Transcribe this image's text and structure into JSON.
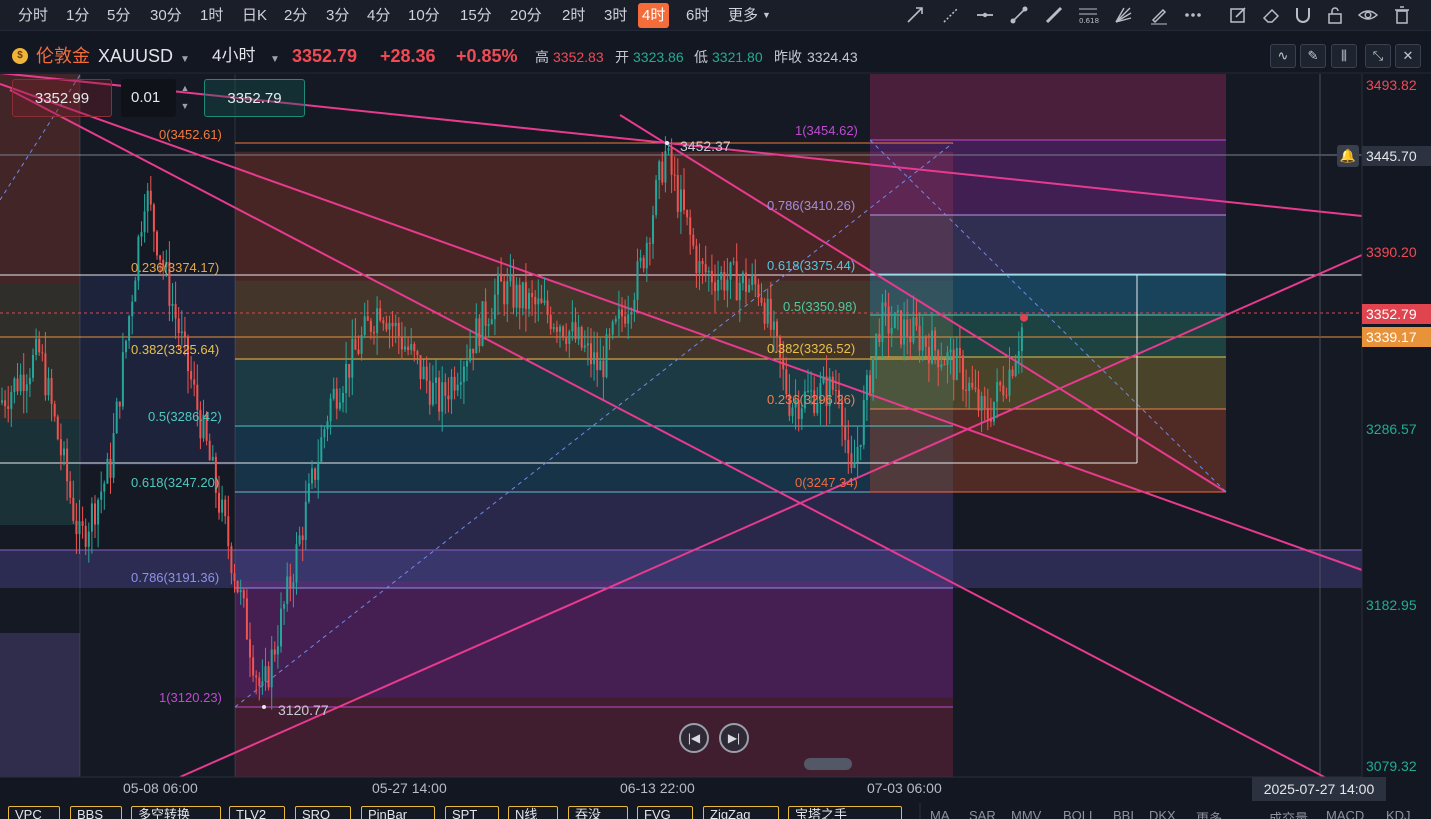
{
  "timeframes": [
    "分时",
    "1分",
    "5分",
    "30分",
    "1时",
    "日K",
    "2分",
    "3分",
    "4分",
    "10分",
    "15分",
    "20分",
    "2时",
    "3时",
    "4时",
    "6时",
    "更多"
  ],
  "active_timeframe": "4时",
  "toolbar_icons": [
    "trend-line-icon",
    "dashed-line-icon",
    "horizontal-line-icon",
    "segment-line-icon",
    "brush-line-icon",
    "fib-retracement-icon",
    "fan-icon",
    "pen-icon",
    "more-dots-icon",
    "edit-icon",
    "eraser-icon",
    "magnet-icon",
    "lock-icon",
    "eye-icon",
    "trash-icon"
  ],
  "symbol": {
    "logo_glyph": "$",
    "name": "伦敦金",
    "code": "XAUUSD",
    "period": "4小时",
    "price": "3352.79",
    "change": "+28.36",
    "change_pct": "+0.85%",
    "high_label": "高",
    "high": "3352.83",
    "open_label": "开",
    "open": "3323.86",
    "low_label": "低",
    "low": "3321.80",
    "prev_close_label": "昨收",
    "prev_close": "3324.43"
  },
  "order": {
    "sell_price": "3352.99",
    "lot": "0.01",
    "buy_price": "3352.79"
  },
  "price_axis": {
    "ticks": [
      "3493.82",
      "3390.20",
      "3286.57",
      "3182.95",
      "3079.32"
    ],
    "alert_level": "3445.70",
    "current_tag": "3352.79",
    "secondary_tag": "3339.17"
  },
  "time_axis": {
    "labels": [
      "05-08 06:00",
      "05-27 14:00",
      "06-13 22:00",
      "07-03 06:00"
    ],
    "cursor": "2025-07-27 14:00"
  },
  "fib_left": [
    "0(3452.61)",
    "0.236(3374.17)",
    "0.382(3325.64)",
    "0.5(3286.42)",
    "0.618(3247.20)",
    "0.786(3191.36)",
    "1(3120.23)"
  ],
  "fib_right": [
    "1(3454.62)",
    "0.786(3410.26)",
    "0.618(3375.44)",
    "0.5(3350.98)",
    "0.382(3326.52)",
    "0.236(3296.26)",
    "0(3247.34)"
  ],
  "price_annotations": {
    "high_mark": "3452.37",
    "low_mark": "3120.77"
  },
  "indicators_main": [
    "VPC",
    "BBS",
    "多空转换",
    "TLV2",
    "SRO",
    "PinBar",
    "SPT",
    "N线",
    "吞没",
    "FVG",
    "ZigZag",
    "宝塔之手"
  ],
  "indicators_sub": [
    "MA",
    "SAR",
    "MMV",
    "BOLL",
    "BBI",
    "DKX",
    "更多",
    "成交量",
    "MACD",
    "KDJ"
  ],
  "colors": {
    "up": "#26a69a",
    "down": "#ef5350",
    "accent": "#f36c3a",
    "price_red": "#f04b55",
    "price_green": "#22ab94"
  },
  "chart_data": {
    "type": "candlestick",
    "price_range": [
      3079.32,
      3493.82
    ],
    "y_ticks": [
      3493.82,
      3390.2,
      3286.57,
      3182.95,
      3079.32
    ],
    "current_price": 3352.79
  }
}
